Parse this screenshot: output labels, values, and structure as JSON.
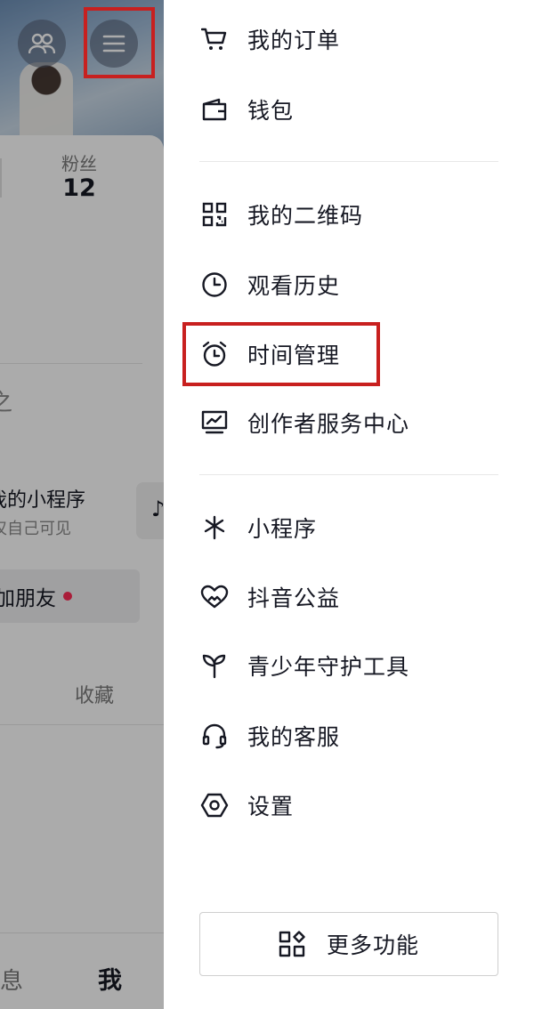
{
  "profile_background": {
    "fans_label": "粉丝",
    "fans_count": "12",
    "partial_text": "之",
    "mini_program_title": "我的小程序",
    "mini_program_subtitle": "仅自己可见",
    "add_friend_label": "加朋友",
    "favorites_label": "收藏",
    "tab_messages": "息",
    "tab_me": "我"
  },
  "drawer": {
    "group1": [
      {
        "label": "我的订单",
        "icon": "cart-icon"
      },
      {
        "label": "钱包",
        "icon": "wallet-icon"
      }
    ],
    "group2": [
      {
        "label": "我的二维码",
        "icon": "qr-code-icon"
      },
      {
        "label": "观看历史",
        "icon": "clock-icon"
      },
      {
        "label": "时间管理",
        "icon": "alarm-clock-icon"
      },
      {
        "label": "创作者服务中心",
        "icon": "creator-monitor-icon"
      }
    ],
    "group3": [
      {
        "label": "小程序",
        "icon": "mini-program-icon"
      },
      {
        "label": "抖音公益",
        "icon": "charity-heart-icon"
      },
      {
        "label": "青少年守护工具",
        "icon": "sprout-icon"
      },
      {
        "label": "我的客服",
        "icon": "headset-icon"
      },
      {
        "label": "设置",
        "icon": "settings-hexagon-icon"
      }
    ],
    "more_button_label": "更多功能"
  },
  "colors": {
    "highlight": "#c8201f",
    "text": "#161823",
    "notification_dot": "#fe2c55"
  }
}
